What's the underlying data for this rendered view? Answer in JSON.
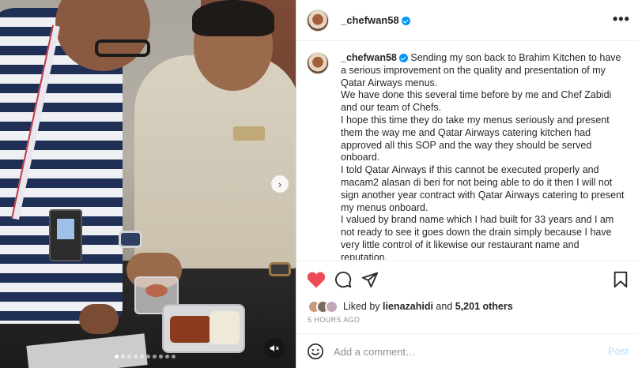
{
  "post": {
    "username": "_chefwan58",
    "verified": true,
    "more_icon": "more-horizontal-icon",
    "more_label": "•••"
  },
  "media": {
    "slide_count": 10,
    "active_slide": 1,
    "next_label": "›",
    "next_icon": "chevron-right-icon",
    "mute_icon": "speaker-muted-icon"
  },
  "caption": {
    "username": "_chefwan58",
    "paragraphs": [
      "Sending my son back to Brahim Kitchen to have a serious improvement on the quality and presentation of my Qatar Airways menus.",
      "We have done this several time before by me and Chef Zabidi and our team of Chefs.",
      "I hope this time they do take my menus seriously and present them the way me and Qatar Airways catering kitchen had approved all this SOP and the way they should be served onboard.",
      "I told Qatar Airways if this cannot be executed properly and macam2 alasan di beri for not being able to do it then I will not sign another year contract with Qatar Airways catering to present my menus onboard.",
      "I valued by brand name which I had built for 33 years and I am not ready to see it goes down the drain simply because I have very little control of it likewise our restaurant name and reputation."
    ]
  },
  "actions": {
    "like_icon": "heart-filled-icon",
    "comment_icon": "comment-bubble-icon",
    "share_icon": "paper-plane-icon",
    "save_icon": "bookmark-icon",
    "like_color": "#ed4956"
  },
  "likes": {
    "prefix": "Liked by ",
    "liker": "lienazahidi",
    "middle": " and ",
    "others": "5,201 others"
  },
  "timestamp": "5 HOURS AGO",
  "comment_box": {
    "emoji_icon": "emoji-smile-icon",
    "placeholder": "Add a comment…",
    "post_label": "Post"
  },
  "colors": {
    "accent": "#0095f6",
    "text": "#262626",
    "muted": "#8e8e8e",
    "post_disabled": "#b3dbff"
  }
}
